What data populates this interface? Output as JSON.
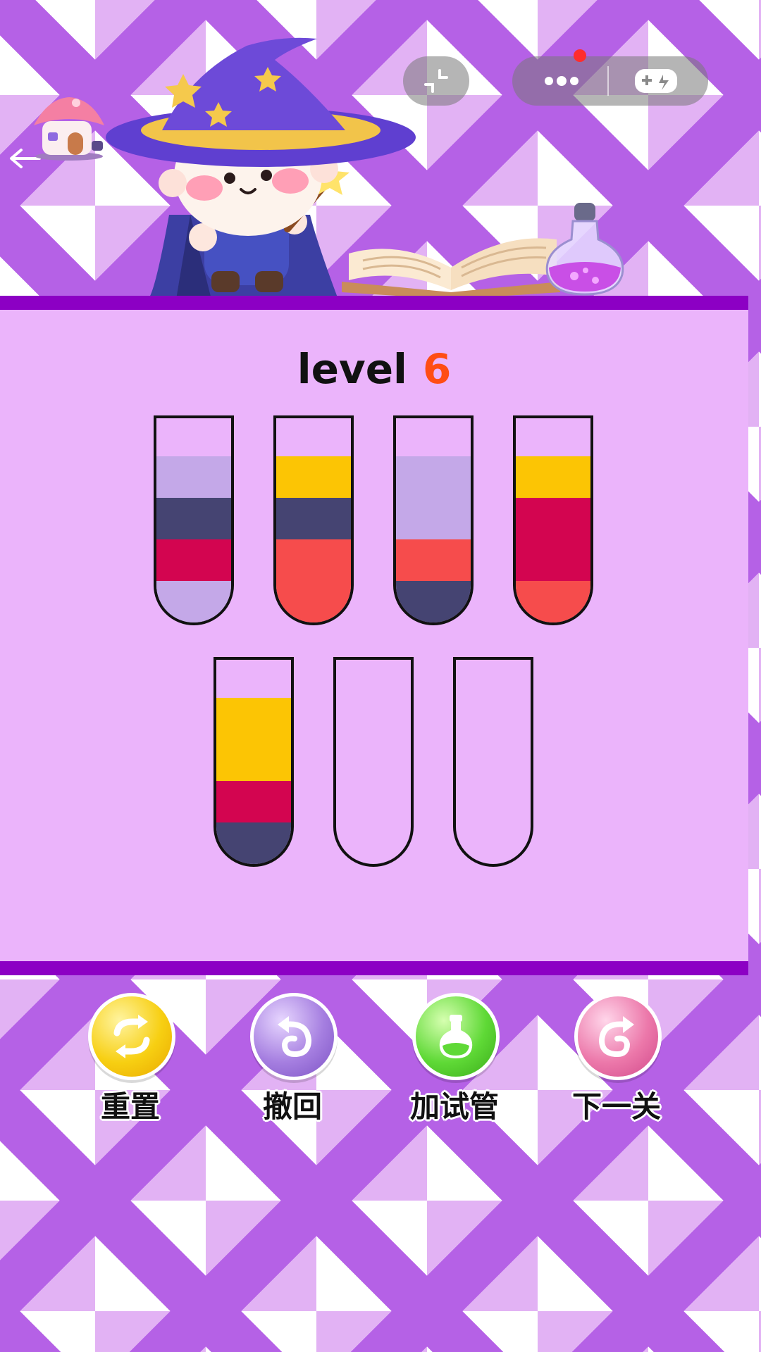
{
  "header": {
    "level_word": "level",
    "level_number": "6",
    "icons": [
      "back-arrow-icon",
      "house-icon",
      "shrink-icon",
      "more-dots-icon",
      "gamepad-icon"
    ]
  },
  "board": {
    "colors": {
      "lavender": "#c4a8e8",
      "navy": "#454472",
      "crimson": "#d30550",
      "yellow": "#fcc504",
      "coral": "#f64c4c"
    },
    "tubes": [
      {
        "layers_top_to_bottom": [
          "lavender",
          "navy",
          "crimson",
          "lavender"
        ]
      },
      {
        "layers_top_to_bottom": [
          "yellow",
          "navy",
          "coral",
          "coral"
        ]
      },
      {
        "layers_top_to_bottom": [
          "lavender",
          "lavender",
          "coral",
          "navy"
        ]
      },
      {
        "layers_top_to_bottom": [
          "yellow",
          "crimson",
          "crimson",
          "coral"
        ]
      },
      {
        "layers_top_to_bottom": [
          "yellow",
          "yellow",
          "crimson",
          "navy"
        ]
      },
      {
        "layers_top_to_bottom": []
      },
      {
        "layers_top_to_bottom": []
      }
    ]
  },
  "controls": {
    "reset": {
      "label": "重置",
      "icon": "reset-icon",
      "color": "#f7cf12"
    },
    "undo": {
      "label": "撤回",
      "icon": "undo-icon",
      "color": "#a57ee0"
    },
    "add_tube": {
      "label": "加试管",
      "icon": "potion-icon",
      "color": "#5fd936"
    },
    "next_level": {
      "label": "下一关",
      "icon": "next-icon",
      "color": "#ec78aa"
    }
  }
}
